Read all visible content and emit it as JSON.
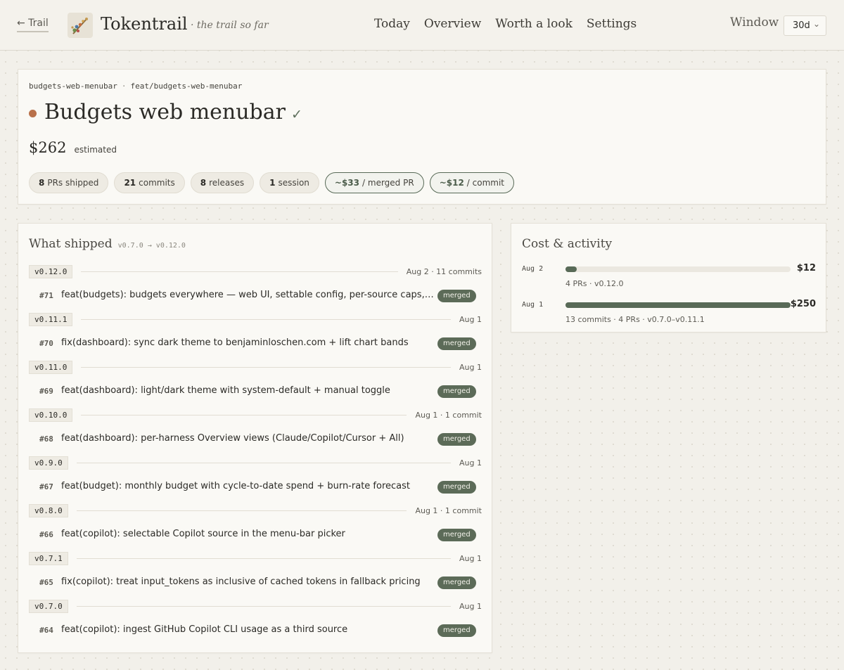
{
  "header": {
    "back_label": "← Trail",
    "brand": "Tokentrail",
    "tagline": "· the trail so far",
    "nav": [
      "Today",
      "Overview",
      "Worth a look",
      "Settings"
    ],
    "window_label": "Window",
    "window_value": "30d"
  },
  "project": {
    "repo": "budgets-web-menubar",
    "separator": "·",
    "branch": "feat/budgets-web-menubar",
    "title": "Budgets web menubar",
    "check": "✓",
    "cost": "$262",
    "cost_note": "estimated",
    "stats": [
      {
        "value": "8",
        "label": "PRs shipped"
      },
      {
        "value": "21",
        "label": "commits"
      },
      {
        "value": "8",
        "label": "releases"
      },
      {
        "value": "1",
        "label": "session"
      },
      {
        "value": "~$33",
        "label": "/ merged PR",
        "outline": true
      },
      {
        "value": "~$12",
        "label": "/ commit",
        "outline": true
      }
    ]
  },
  "shipped": {
    "title": "What shipped",
    "range": "v0.7.0 → v0.12.0",
    "releases": [
      {
        "tag": "v0.12.0",
        "meta": "Aug 2 · 11 commits",
        "pr": "#71",
        "pr_title": "feat(budgets): budgets everywhere — web UI, settable config, per-source caps, …",
        "status": "merged"
      },
      {
        "tag": "v0.11.1",
        "meta": "Aug 1",
        "pr": "#70",
        "pr_title": "fix(dashboard): sync dark theme to benjaminloschen.com + lift chart bands",
        "status": "merged"
      },
      {
        "tag": "v0.11.0",
        "meta": "Aug 1",
        "pr": "#69",
        "pr_title": "feat(dashboard): light/dark theme with system-default + manual toggle",
        "status": "merged"
      },
      {
        "tag": "v0.10.0",
        "meta": "Aug 1 · 1 commit",
        "pr": "#68",
        "pr_title": "feat(dashboard): per-harness Overview views (Claude/Copilot/Cursor + All)",
        "status": "merged"
      },
      {
        "tag": "v0.9.0",
        "meta": "Aug 1",
        "pr": "#67",
        "pr_title": "feat(budget): monthly budget with cycle-to-date spend + burn-rate forecast",
        "status": "merged"
      },
      {
        "tag": "v0.8.0",
        "meta": "Aug 1 · 1 commit",
        "pr": "#66",
        "pr_title": "feat(copilot): selectable Copilot source in the menu-bar picker",
        "status": "merged"
      },
      {
        "tag": "v0.7.1",
        "meta": "Aug 1",
        "pr": "#65",
        "pr_title": "fix(copilot): treat input_tokens as inclusive of cached tokens in fallback pricing",
        "status": "merged"
      },
      {
        "tag": "v0.7.0",
        "meta": "Aug 1",
        "pr": "#64",
        "pr_title": "feat(copilot): ingest GitHub Copilot CLI usage as a third source",
        "status": "merged"
      }
    ]
  },
  "activity": {
    "title": "Cost & activity",
    "rows": [
      {
        "date": "Aug 2",
        "amount": "$12",
        "value": 12,
        "detail": "4 PRs · v0.12.0"
      },
      {
        "date": "Aug 1",
        "amount": "$250",
        "value": 250,
        "detail": "13 commits · 4 PRs · v0.7.0–v0.11.1"
      }
    ],
    "max": 250
  },
  "colors": {
    "accent": "#586a57",
    "project_dot": "#b9714a",
    "badge": "#5c6b58"
  }
}
